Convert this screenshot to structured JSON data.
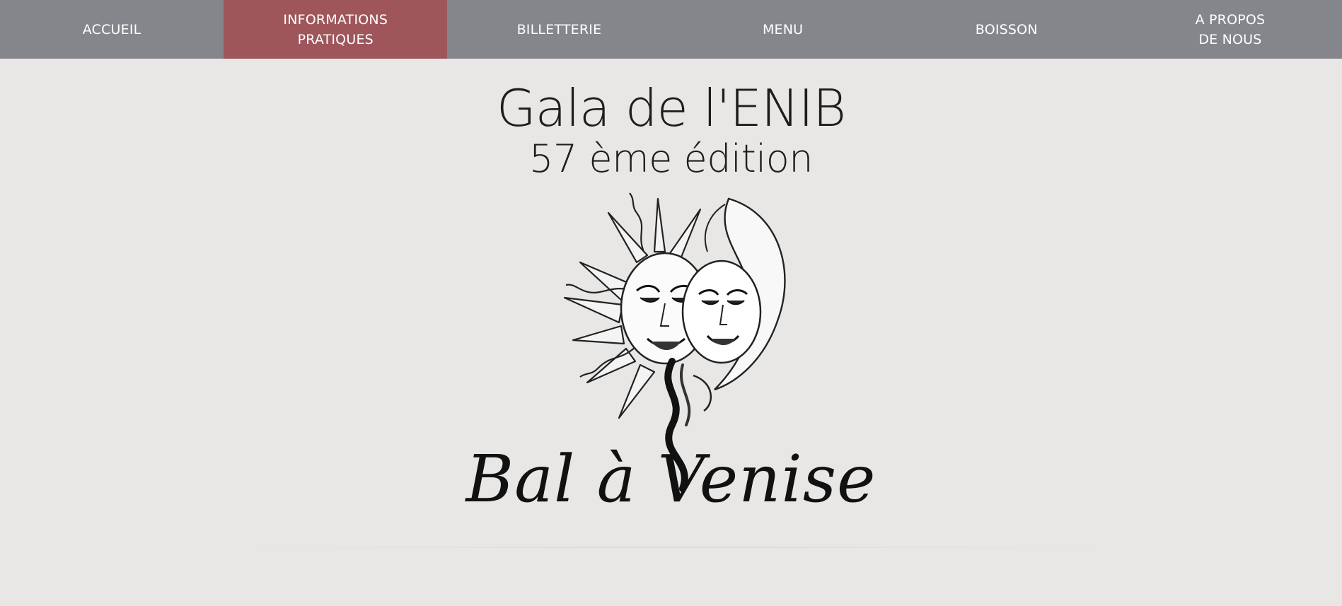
{
  "nav": {
    "items": [
      {
        "label": "ACCUEIL",
        "active": false
      },
      {
        "label": "INFORMATIONS\nPRATIQUES",
        "active": true
      },
      {
        "label": "BILLETTERIE",
        "active": false
      },
      {
        "label": "MENU",
        "active": false
      },
      {
        "label": "BOISSON",
        "active": false
      },
      {
        "label": "A PROPOS\nDE NOUS",
        "active": false
      }
    ],
    "colors": {
      "bar": "#84868b",
      "active": "#9e565b",
      "text": "#ffffff"
    }
  },
  "hero": {
    "title": "Gala de l'ENIB",
    "edition": "57 ème édition",
    "script": "Bal à Venise",
    "emblem_icon": "sun-moon-masks-icon",
    "background": "#e8e7e5"
  }
}
